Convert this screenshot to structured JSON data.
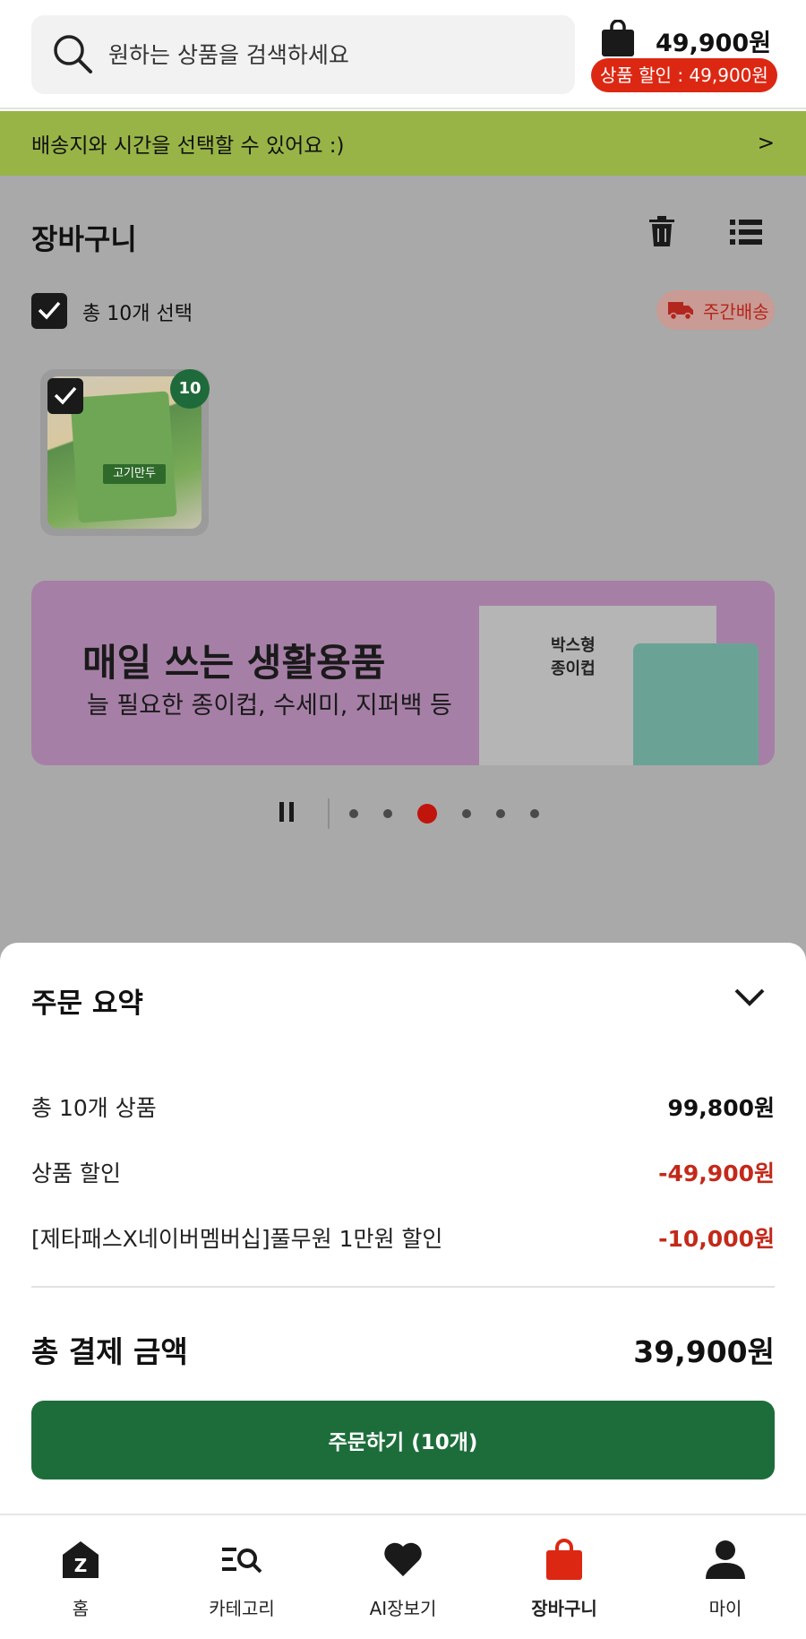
{
  "header": {
    "search_placeholder": "원하는 상품을 검색하세요",
    "cart_total": "49,900원",
    "discount_badge": "상품 할인 : 49,900원"
  },
  "delivery_bar": {
    "text": "배송지와 시간을 선택할 수 있어요 :)",
    "arrow": ">"
  },
  "cart": {
    "title": "장바구니",
    "select_all_label": "총 10개 선택",
    "delivery_badge": "주간배송",
    "product": {
      "quantity": "10",
      "package_text": "고기만두"
    }
  },
  "promo_banner": {
    "headline": "매일 쓰는 생활용품",
    "subline": "늘 필요한 종이컵, 수세미, 지퍼백 등",
    "box_label_1": "박스형",
    "box_label_2": "종이컵",
    "carousel_pages": 6,
    "active_page": 3
  },
  "summary": {
    "title": "주문 요약",
    "rows": [
      {
        "label": "총 10개 상품",
        "value": "99,800원"
      },
      {
        "label": "상품 할인",
        "value": "-49,900원"
      },
      {
        "label": "[제타패스X네이버멤버십]풀무원 1만원 할인",
        "value": "-10,000원"
      }
    ],
    "total_label": "총 결제 금액",
    "total_value": "39,900원",
    "order_button": "주문하기 (10개)"
  },
  "tabbar": {
    "items": [
      {
        "label": "홈",
        "icon": "home-icon"
      },
      {
        "label": "카테고리",
        "icon": "category-search-icon"
      },
      {
        "label": "AI장보기",
        "icon": "heart-icon"
      },
      {
        "label": "장바구니",
        "icon": "shopping-bag-icon",
        "active": true
      },
      {
        "label": "마이",
        "icon": "person-icon"
      }
    ]
  },
  "colors": {
    "brand_green": "#1d6d3b",
    "discount_red": "#dc2813",
    "delivery_bar": "#98b446"
  }
}
